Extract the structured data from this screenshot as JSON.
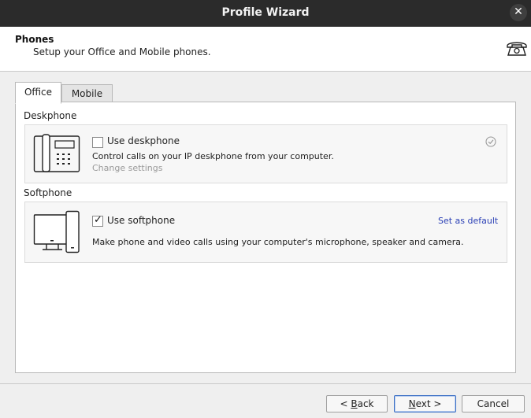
{
  "window": {
    "title": "Profile Wizard",
    "close_glyph": "✕"
  },
  "header": {
    "title": "Phones",
    "subtitle": "Setup your Office and Mobile phones.",
    "icon": "telephone-icon"
  },
  "tabs": [
    {
      "label": "Office",
      "active": true
    },
    {
      "label": "Mobile",
      "active": false
    }
  ],
  "deskphone": {
    "section_label": "Deskphone",
    "checkbox_label": "Use deskphone",
    "checked": false,
    "description": "Control calls on your IP deskphone from your computer.",
    "settings_link": "Change settings"
  },
  "softphone": {
    "section_label": "Softphone",
    "checkbox_label": "Use softphone",
    "checked": true,
    "default_link": "Set as default",
    "description": "Make phone and video calls using your computer's microphone, speaker and camera."
  },
  "footer": {
    "back_label": "< ",
    "back_underlined": "B",
    "back_rest": "ack",
    "next_underlined": "N",
    "next_rest": "ext >",
    "cancel_label": "Cancel"
  },
  "colors": {
    "titlebar": "#2b2b2b",
    "link": "#2a3fb5",
    "disabled_link": "#9a9a9a"
  }
}
